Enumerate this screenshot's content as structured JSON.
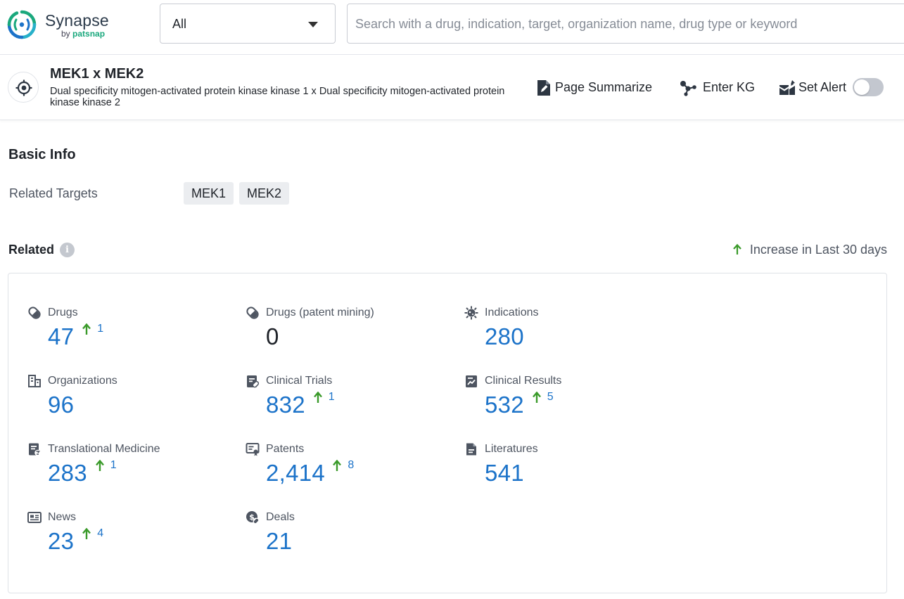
{
  "app": {
    "logo_name": "Synapse",
    "logo_by": "by",
    "logo_brand": "patsnap",
    "brand_colors": {
      "teal": "#1aa87d",
      "blue": "#1c73c9",
      "increase_green": "#3a9a2a"
    }
  },
  "search": {
    "scope_value": "All",
    "placeholder": "Search with a drug, indication, target, organization name, drug type or keyword",
    "value": ""
  },
  "entity": {
    "icon": "target-icon",
    "title": "MEK1 x MEK2",
    "description": "Dual specificity mitogen-activated protein kinase kinase 1 x Dual specificity mitogen-activated protein kinase kinase 2",
    "actions": {
      "summarize_label": "Page Summarize",
      "kg_label": "Enter KG",
      "alert_label": "Set Alert",
      "alert_enabled": false
    }
  },
  "basic_info": {
    "title": "Basic Info",
    "related_targets_label": "Related Targets",
    "targets": [
      "MEK1",
      "MEK2"
    ]
  },
  "related": {
    "title": "Related",
    "legend_label": "Increase in Last 30 days",
    "stats": [
      {
        "name": "Drugs",
        "icon": "pill-icon",
        "value": "47",
        "increase": "1"
      },
      {
        "name": "Drugs (patent mining)",
        "icon": "pill-icon",
        "value": "0",
        "increase": ""
      },
      {
        "name": "Indications",
        "icon": "virus-icon",
        "value": "280",
        "increase": ""
      },
      {
        "name": "Organizations",
        "icon": "building-icon",
        "value": "96",
        "increase": ""
      },
      {
        "name": "Clinical Trials",
        "icon": "clipboard-pill-icon",
        "value": "832",
        "increase": "1"
      },
      {
        "name": "Clinical Results",
        "icon": "chart-report-icon",
        "value": "532",
        "increase": "5"
      },
      {
        "name": "Translational Medicine",
        "icon": "document-flask-icon",
        "value": "283",
        "increase": "1"
      },
      {
        "name": "Patents",
        "icon": "certificate-icon",
        "value": "2,414",
        "increase": "8"
      },
      {
        "name": "Literatures",
        "icon": "document-icon",
        "value": "541",
        "increase": ""
      },
      {
        "name": "News",
        "icon": "newspaper-icon",
        "value": "23",
        "increase": "4"
      },
      {
        "name": "Deals",
        "icon": "coins-icon",
        "value": "21",
        "increase": ""
      }
    ]
  }
}
